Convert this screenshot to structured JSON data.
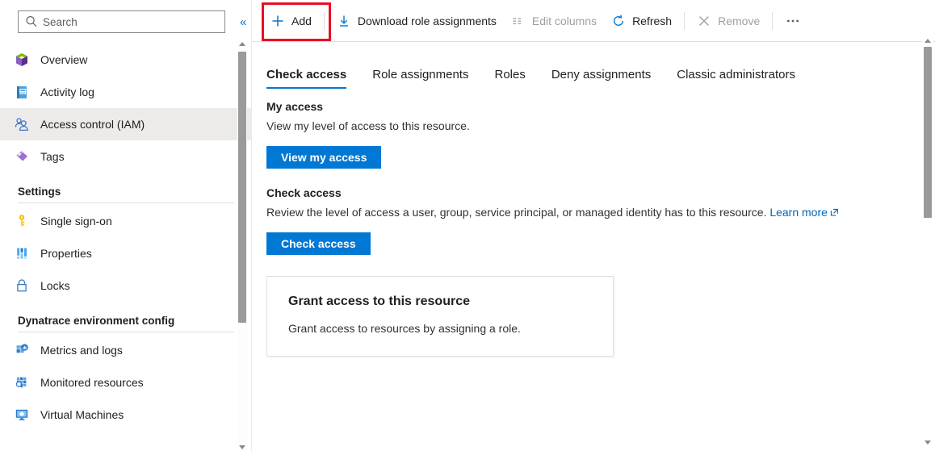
{
  "sidebar": {
    "search": {
      "placeholder": "Search",
      "value": "",
      "icon": "search-icon"
    },
    "collapse": {
      "icon": "chevron-double-left-icon",
      "glyph": "«"
    },
    "items": [
      {
        "label": "Overview",
        "icon": "cube-icon",
        "selected": false
      },
      {
        "label": "Activity log",
        "icon": "activity-log-book-icon",
        "selected": false
      },
      {
        "label": "Access control (IAM)",
        "icon": "people-icon",
        "selected": true
      },
      {
        "label": "Tags",
        "icon": "tag-icon",
        "selected": false
      }
    ],
    "groups": [
      {
        "title": "Settings",
        "items": [
          {
            "label": "Single sign-on",
            "icon": "key-icon"
          },
          {
            "label": "Properties",
            "icon": "properties-bars-icon"
          },
          {
            "label": "Locks",
            "icon": "lock-icon"
          }
        ]
      },
      {
        "title": "Dynatrace environment config",
        "items": [
          {
            "label": "Metrics and logs",
            "icon": "metrics-logs-icon"
          },
          {
            "label": "Monitored resources",
            "icon": "monitored-resources-icon"
          },
          {
            "label": "Virtual Machines",
            "icon": "virtual-machine-icon"
          }
        ]
      }
    ]
  },
  "toolbar": {
    "add_label": "Add",
    "download_label": "Download role assignments",
    "edit_columns_label": "Edit columns",
    "refresh_label": "Refresh",
    "remove_label": "Remove",
    "more_label": "•••",
    "highlight_color": "#e81123"
  },
  "tabs": [
    {
      "label": "Check access",
      "active": true
    },
    {
      "label": "Role assignments",
      "active": false
    },
    {
      "label": "Roles",
      "active": false
    },
    {
      "label": "Deny assignments",
      "active": false
    },
    {
      "label": "Classic administrators",
      "active": false
    }
  ],
  "content": {
    "my_access": {
      "title": "My access",
      "description": "View my level of access to this resource.",
      "button": "View my access"
    },
    "check_access": {
      "title": "Check access",
      "description": "Review the level of access a user, group, service principal, or managed identity has to this resource.",
      "link_text": "Learn more",
      "button": "Check access"
    },
    "grant_card": {
      "title": "Grant access to this resource",
      "description": "Grant access to resources by assigning a role."
    }
  },
  "colors": {
    "accent": "#0078d4",
    "link": "#0067b8",
    "selected_bg": "#edebe9",
    "disabled_text": "#a19f9d",
    "highlight": "#e81123"
  }
}
